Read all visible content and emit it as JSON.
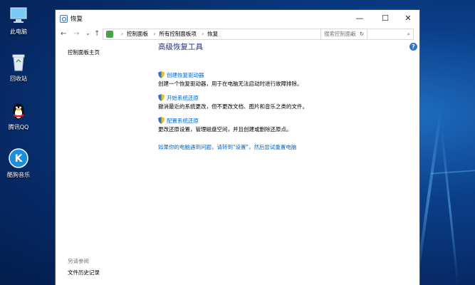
{
  "desktop": {
    "icons": [
      {
        "label": "此电脑",
        "name": "this-pc-icon"
      },
      {
        "label": "回收站",
        "name": "recycle-bin-icon"
      },
      {
        "label": "腾讯QQ",
        "name": "qq-icon"
      },
      {
        "label": "酷狗音乐",
        "name": "kugou-icon"
      }
    ]
  },
  "window": {
    "title": "恢复",
    "minimize": "—",
    "maximize": "☐",
    "close": "✕",
    "nav": {
      "back": "←",
      "forward": "→",
      "down": "⌄",
      "up": "↑"
    },
    "breadcrumb": [
      "控制面板",
      "所有控制面板项",
      "恢复"
    ],
    "breadcrumb_sep": "›",
    "dropdown": "⌄",
    "refresh": "↻",
    "search": {
      "placeholder": "搜索控制面板",
      "icon": "⌕"
    },
    "help": "?",
    "sidebar": {
      "home": "控制面板主页",
      "see_also_heading": "另请参阅",
      "see_also_link": "文件历史记录"
    },
    "main": {
      "title": "高级恢复工具",
      "items": [
        {
          "link": "创建恢复驱动器",
          "desc": "创建一个恢复驱动器，用于在电脑无法启动时进行故障排除。"
        },
        {
          "link": "开始系统还原",
          "desc": "撤消最近的系统更改，但不更改文档、图片和音乐之类的文件。"
        },
        {
          "link": "配置系统还原",
          "desc": "更改还原设置，管理磁盘空间，并且创建或删除还原点。"
        }
      ],
      "bottom_link": "如果你的电脑遇到问题，请转到\"设置\"，然后尝试重置电脑"
    }
  }
}
